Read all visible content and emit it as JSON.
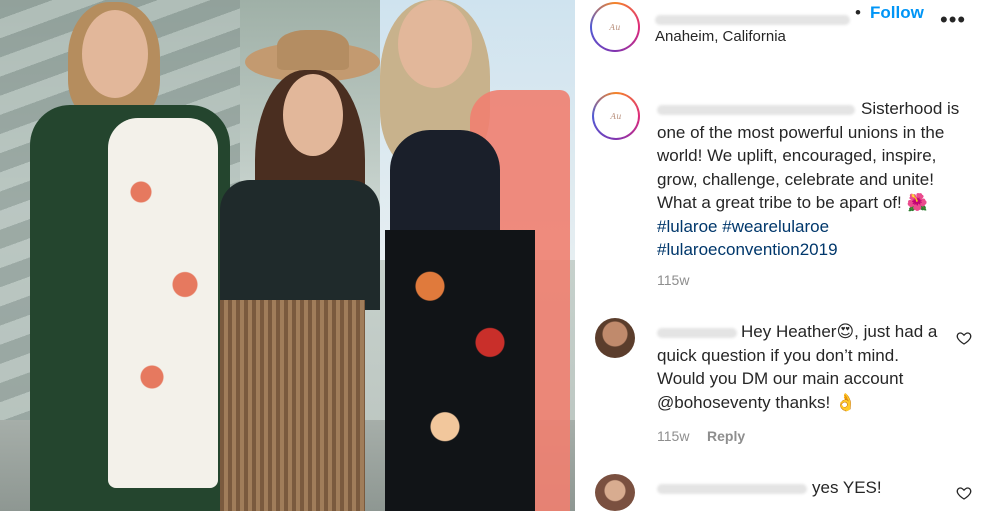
{
  "header": {
    "follow_separator": "•",
    "follow_label": "Follow",
    "location": "Anaheim, California",
    "more_label": "•••"
  },
  "caption": {
    "text": "Sisterhood is one of the most powerful unions in the world! We uplift, encouraged, inspire, grow, challenge, celebrate and unite! What a great tribe to be apart of!",
    "emoji": "🌺",
    "hashtags": [
      "#lularoe",
      "#wearelularoe",
      "#lularoeconvention2019"
    ],
    "age": "115w"
  },
  "comments": [
    {
      "text_before": "Hey Heather",
      "emoji": "😍",
      "text_after": ", just had a quick question if you don’t mind. Would you DM our main account @bohoseventy thanks!",
      "emoji2": "👌",
      "age": "115w",
      "reply_label": "Reply"
    },
    {
      "text": "yes YES!"
    }
  ],
  "colors": {
    "follow": "#0095f6",
    "hashtag": "#00376b",
    "muted": "#8e8e8e"
  },
  "icons": [
    "more-options-icon",
    "heart-icon"
  ]
}
